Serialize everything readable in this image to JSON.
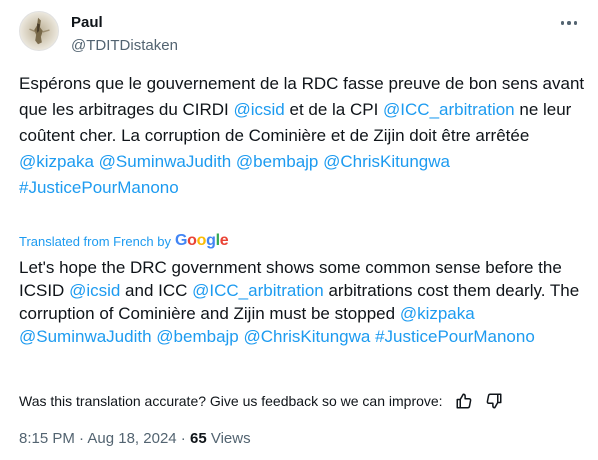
{
  "author": {
    "name": "Paul",
    "handle": "@TDITDistaken"
  },
  "original_text": [
    {
      "t": "Espérons que le gouvernement de la RDC fasse preuve de bon sens avant que les arbitrages du CIRDI ",
      "link": false
    },
    {
      "t": "@icsid",
      "link": true
    },
    {
      "t": " et de la CPI ",
      "link": false
    },
    {
      "t": "@ICC_arbitration",
      "link": true
    },
    {
      "t": " ne leur coûtent cher. La corruption de Cominière et de Zijin doit être arrêtée ",
      "link": false
    },
    {
      "t": "@kizpaka",
      "link": true
    },
    {
      "t": " ",
      "link": false
    },
    {
      "t": "@SuminwaJudith",
      "link": true
    },
    {
      "t": " ",
      "link": false
    },
    {
      "t": "@bembajp",
      "link": true
    },
    {
      "t": " ",
      "link": false
    },
    {
      "t": "@ChrisKitungwa",
      "link": true
    },
    {
      "t": " ",
      "link": false
    },
    {
      "t": "#JusticePourManono",
      "link": true
    }
  ],
  "translation": {
    "label": "Translated from French by",
    "provider": "Google",
    "text": [
      {
        "t": "Let's hope the DRC government shows some common sense before the ICSID ",
        "link": false
      },
      {
        "t": "@icsid",
        "link": true
      },
      {
        "t": " and ICC ",
        "link": false
      },
      {
        "t": "@ICC_arbitration",
        "link": true
      },
      {
        "t": " arbitrations cost them dearly. The corruption of Cominière and Zijin must be stopped ",
        "link": false
      },
      {
        "t": "@kizpaka",
        "link": true
      },
      {
        "t": " ",
        "link": false
      },
      {
        "t": "@SuminwaJudith",
        "link": true
      },
      {
        "t": " ",
        "link": false
      },
      {
        "t": "@bembajp",
        "link": true
      },
      {
        "t": " ",
        "link": false
      },
      {
        "t": "@ChrisKitungwa",
        "link": true
      },
      {
        "t": " ",
        "link": false
      },
      {
        "t": "#JusticePourManono",
        "link": true
      }
    ]
  },
  "feedback": {
    "prompt": "Was this translation accurate? Give us feedback so we can improve:"
  },
  "meta": {
    "time": "8:15 PM",
    "sep1": " · ",
    "date": "Aug 18, 2024",
    "sep2": " · ",
    "views_count": "65",
    "views_label": " Views"
  },
  "icons": {
    "more": "more-dots-icon",
    "thumbs_up": "thumbs-up-icon",
    "thumbs_down": "thumbs-down-icon"
  },
  "colors": {
    "link": "#1d9bf0",
    "secondary": "#536471",
    "text": "#0f1419"
  }
}
